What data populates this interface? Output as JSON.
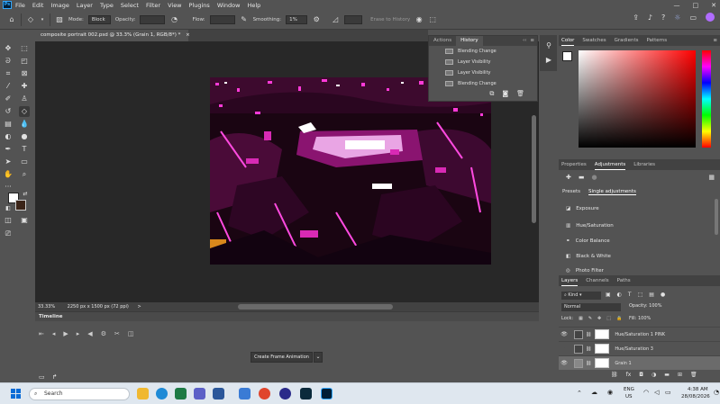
{
  "menu": {
    "logo": "Ps",
    "items": [
      "File",
      "Edit",
      "Image",
      "Layer",
      "Type",
      "Select",
      "Filter",
      "View",
      "Plugins",
      "Window",
      "Help"
    ],
    "window_controls": [
      "—",
      "□",
      "✕"
    ]
  },
  "options": {
    "mode_label": "Mode:",
    "mode_value": "Block",
    "opacity_label": "Opacity:",
    "opacity_value": "",
    "flow_label": "Flow:",
    "flow_value": "",
    "smoothing_label": "Smoothing:",
    "smoothing_value": "1%",
    "erase_history_label": "Erase to History"
  },
  "document": {
    "tab_title": "composite portrait 002.psd @ 33.3% (Grain 1, RGB/8*) *",
    "tab_close": "×",
    "zoom": "33.33%",
    "doc_info": "2250 px x 1500 px (72 ppi)",
    "arrow": ">"
  },
  "history_panel": {
    "tabs": [
      "Actions",
      "History"
    ],
    "items": [
      "Blending Change",
      "Layer Visibility",
      "Layer Visibility",
      "Blending Change"
    ],
    "collapse_glyph": "‹‹",
    "menu_glyph": "≡"
  },
  "timeline": {
    "title": "Timeline",
    "create_button": "Create Frame Animation"
  },
  "color_panel": {
    "tabs": [
      "Color",
      "Swatches",
      "Gradients",
      "Patterns"
    ],
    "foreground": "#ffffff",
    "background": "#3b2418"
  },
  "adjustments_panel": {
    "tabs": [
      "Properties",
      "Adjustments",
      "Libraries"
    ],
    "subtabs": [
      "Presets",
      "Single adjustments"
    ],
    "items": [
      "Exposure",
      "Hue/Saturation",
      "Color Balance",
      "Black & White",
      "Photo Filter"
    ]
  },
  "layers_panel": {
    "tabs": [
      "Layers",
      "Channels",
      "Paths"
    ],
    "kind_label": "Kind",
    "blend_mode": "Normal",
    "opacity_label": "Opacity:",
    "opacity_value": "100%",
    "lock_label": "Lock:",
    "fill_label": "Fill:",
    "fill_value": "100%",
    "layers": [
      {
        "name": "Hue/Saturation 1 PINK",
        "visible": true,
        "selected": false
      },
      {
        "name": "Hue/Saturation 3",
        "visible": false,
        "selected": false
      },
      {
        "name": "Grain 1",
        "visible": true,
        "selected": true
      }
    ]
  },
  "taskbar": {
    "search_placeholder": "Search",
    "lang_top": "ENG",
    "lang_bottom": "US",
    "time": "4:38 AM",
    "date": "28/08/2026"
  },
  "colors": {
    "ui_dark": "#535353",
    "canvas_bg": "#282828",
    "accent_pink": "#ff1fd0"
  }
}
